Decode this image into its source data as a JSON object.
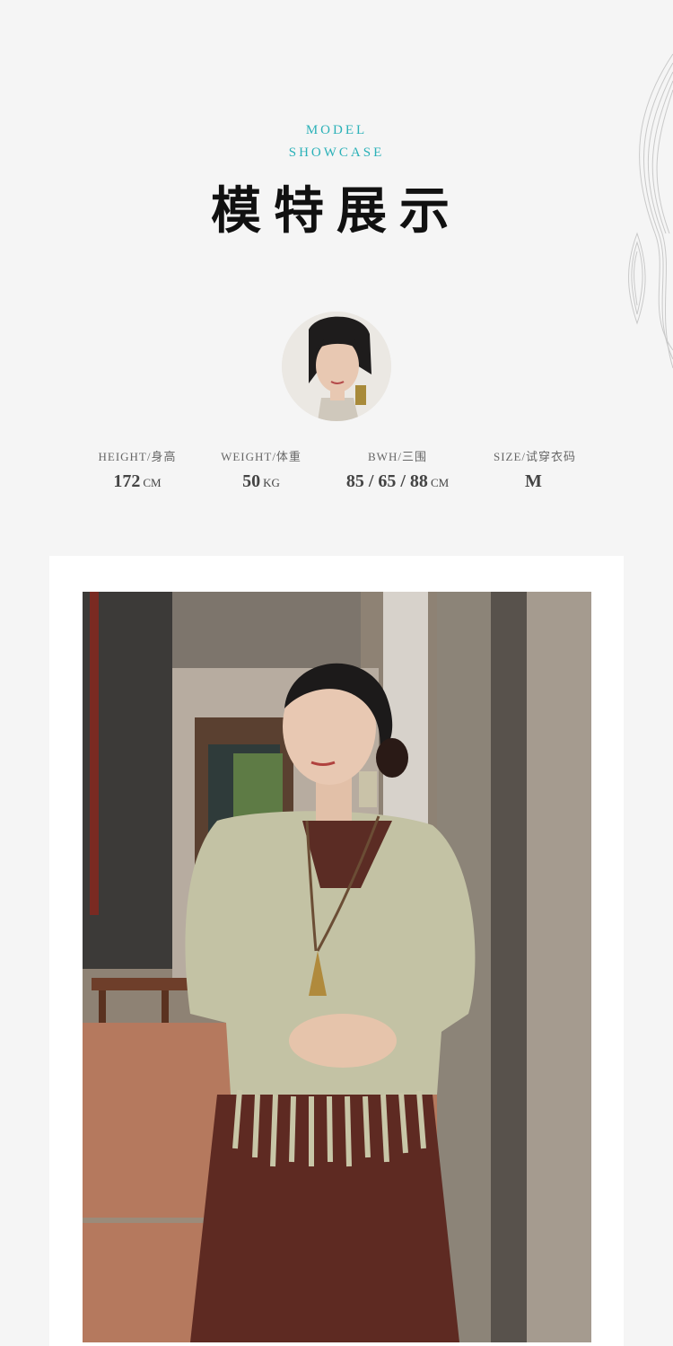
{
  "heading": {
    "en_line1": "MODEL",
    "en_line2": "SHOWCASE",
    "zh_title": "模特展示"
  },
  "model": {
    "specs": [
      {
        "label": "HEIGHT/身高",
        "value": "172",
        "unit": "CM"
      },
      {
        "label": "WEIGHT/体重",
        "value": "50",
        "unit": "KG"
      },
      {
        "label": "BWH/三围",
        "value": "85 / 65 / 88",
        "unit": "CM"
      },
      {
        "label": "SIZE/试穿衣码",
        "value": "M",
        "unit": ""
      }
    ]
  },
  "colors": {
    "accent": "#2bb1b8",
    "title": "#111111",
    "background": "#f5f5f5"
  }
}
